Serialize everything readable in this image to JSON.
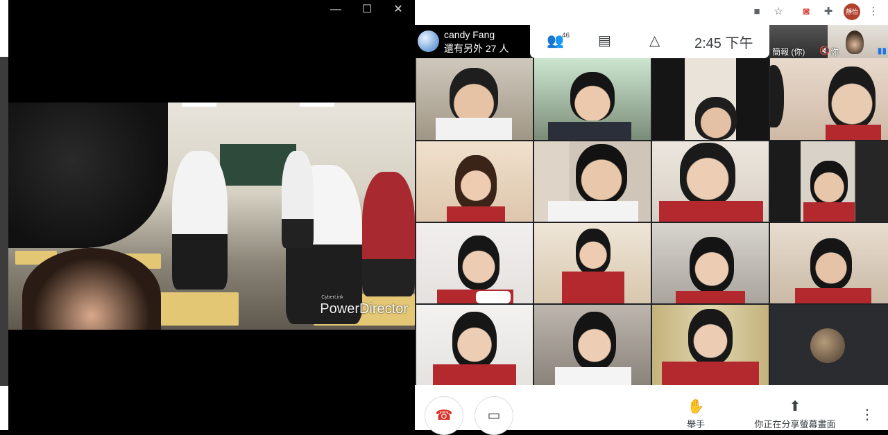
{
  "player": {
    "controls": {
      "minimize": "—",
      "maximize": "☐",
      "close": "✕"
    },
    "watermark_small": "CyberLink",
    "watermark": "PowerDirector"
  },
  "browser": {
    "icons": [
      "camera-icon",
      "star-icon",
      "pocket-icon",
      "extensions-icon"
    ],
    "profile_initials": "靜怡",
    "menu": "⋮"
  },
  "meet": {
    "presenter": {
      "name": "candy Fang",
      "others": "還有另外 27 人"
    },
    "people_count": "46",
    "clock": "2:45 下午",
    "self_view": {
      "label": "簡報 (你)",
      "you": "你"
    },
    "controls": {
      "hangup_icon": "hangup-icon",
      "camera_icon": "camera-icon",
      "raise_hand": "舉手",
      "presenting": "你正在分享螢幕畫面"
    }
  }
}
